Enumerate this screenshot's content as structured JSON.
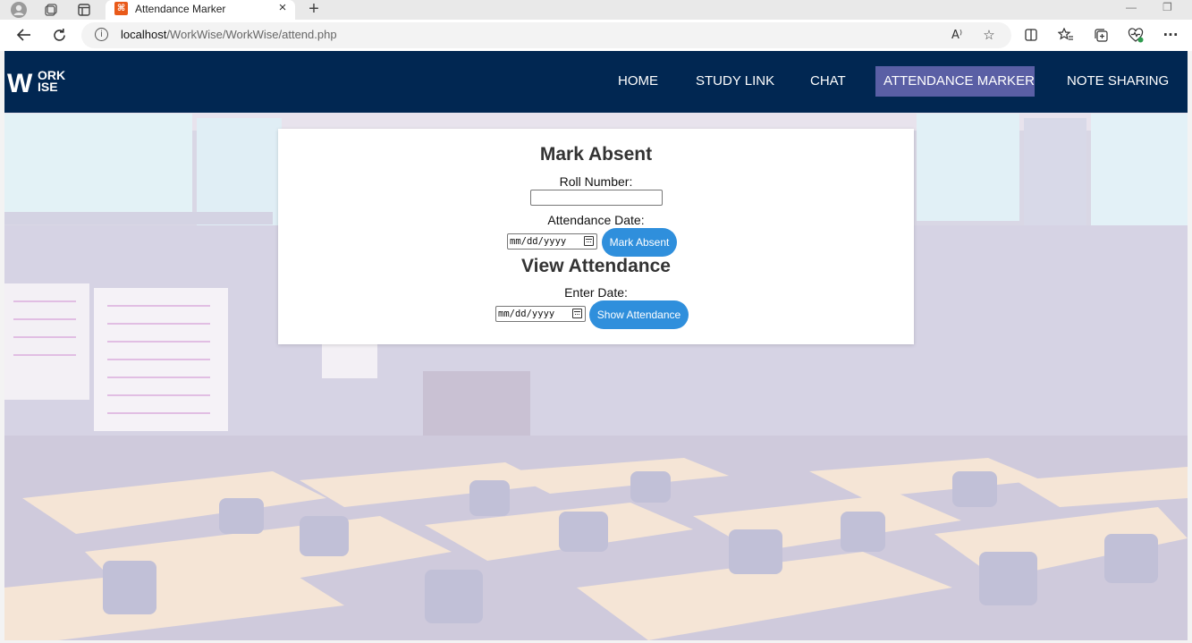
{
  "browser": {
    "tab_title": "Attendance Marker",
    "tab_favicon_glyph": "⌘",
    "url_host": "localhost",
    "url_path": "/WorkWise/WorkWise/attend.php",
    "read_aloud_label": "A⁾"
  },
  "site": {
    "logo_letters": {
      "w": "W",
      "ork": "ORK",
      "ise": "ISE"
    },
    "nav": [
      {
        "label": "HOME",
        "active": false
      },
      {
        "label": "STUDY LINK",
        "active": false
      },
      {
        "label": "CHAT",
        "active": false
      },
      {
        "label": "ATTENDANCE MARKER",
        "active": true
      },
      {
        "label": "NOTE SHARING",
        "active": false
      }
    ],
    "colors": {
      "navbar": "#012752",
      "active_nav": "#5a5fa5",
      "button": "#2f8fdc"
    }
  },
  "mark_absent": {
    "heading": "Mark Absent",
    "roll_label": "Roll Number:",
    "roll_value": "",
    "date_label": "Attendance Date:",
    "date_placeholder": "mm/dd/yyyy",
    "button_label": "Mark Absent"
  },
  "view_attendance": {
    "heading": "View Attendance",
    "date_label": "Enter Date:",
    "date_placeholder": "mm/dd/yyyy",
    "button_label": "Show Attendance"
  }
}
